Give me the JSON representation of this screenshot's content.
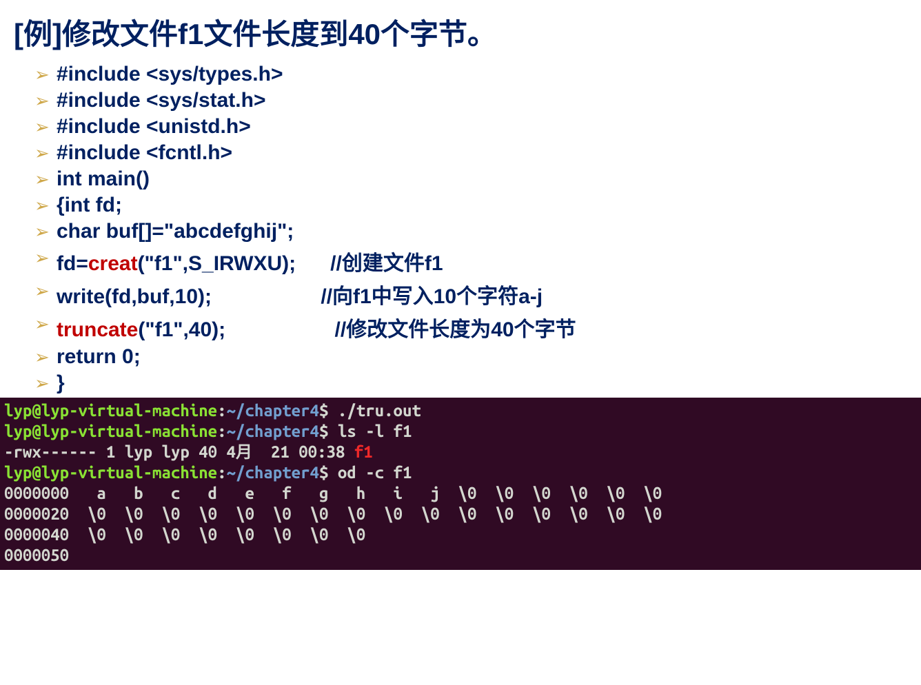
{
  "title": "[例]修改文件f1文件长度到40个字节。",
  "code": [
    {
      "pre": "",
      "mid": "",
      "post": "#include <sys/types.h>",
      "c": ""
    },
    {
      "pre": "",
      "mid": "",
      "post": "#include <sys/stat.h>",
      "c": ""
    },
    {
      "pre": "",
      "mid": "",
      "post": "#include <unistd.h>",
      "c": ""
    },
    {
      "pre": "",
      "mid": "",
      "post": "#include <fcntl.h>",
      "c": ""
    },
    {
      "pre": "",
      "mid": "",
      "post": "int main()",
      "c": ""
    },
    {
      "pre": "",
      "mid": "",
      "post": "{int fd;",
      "c": ""
    },
    {
      "pre": "",
      "mid": "",
      "post": "char buf[]=\"abcdefghij\";",
      "c": ""
    },
    {
      "pre": "fd=",
      "mid": "creat",
      "post": "(\"f1\",S_IRWXU);      ",
      "c": "//创建文件f1"
    },
    {
      "pre": "",
      "mid": "",
      "post": "write(fd,buf,10);                   ",
      "c": "//向f1中写入10个字符a-j"
    },
    {
      "pre": "",
      "mid": "truncate",
      "post": "(\"f1\",40);                   ",
      "c": "//修改文件长度为40个字节"
    },
    {
      "pre": "",
      "mid": "",
      "post": "return 0;",
      "c": ""
    },
    {
      "pre": "",
      "mid": "",
      "post": "}",
      "c": ""
    }
  ],
  "term": {
    "line1": {
      "user": "lyp@lyp-virtual-machine",
      "sep": ":",
      "path": "~/chapter4",
      "prompt": "$ ",
      "cmd": "./tru.out"
    },
    "line2": {
      "user": "lyp@lyp-virtual-machine",
      "sep": ":",
      "path": "~/chapter4",
      "prompt": "$ ",
      "cmd": "ls -l f1"
    },
    "line3a": "-rwx------ 1 lyp lyp 40 4月  21 00:38 ",
    "line3b": "f1",
    "line4": {
      "user": "lyp@lyp-virtual-machine",
      "sep": ":",
      "path": "~/chapter4",
      "prompt": "$ ",
      "cmd": "od -c f1"
    },
    "od1": "0000000   a   b   c   d   e   f   g   h   i   j  \\0  \\0  \\0  \\0  \\0  \\0",
    "od2": "0000020  \\0  \\0  \\0  \\0  \\0  \\0  \\0  \\0  \\0  \\0  \\0  \\0  \\0  \\0  \\0  \\0",
    "od3": "0000040  \\0  \\0  \\0  \\0  \\0  \\0  \\0  \\0",
    "od4": "0000050"
  }
}
